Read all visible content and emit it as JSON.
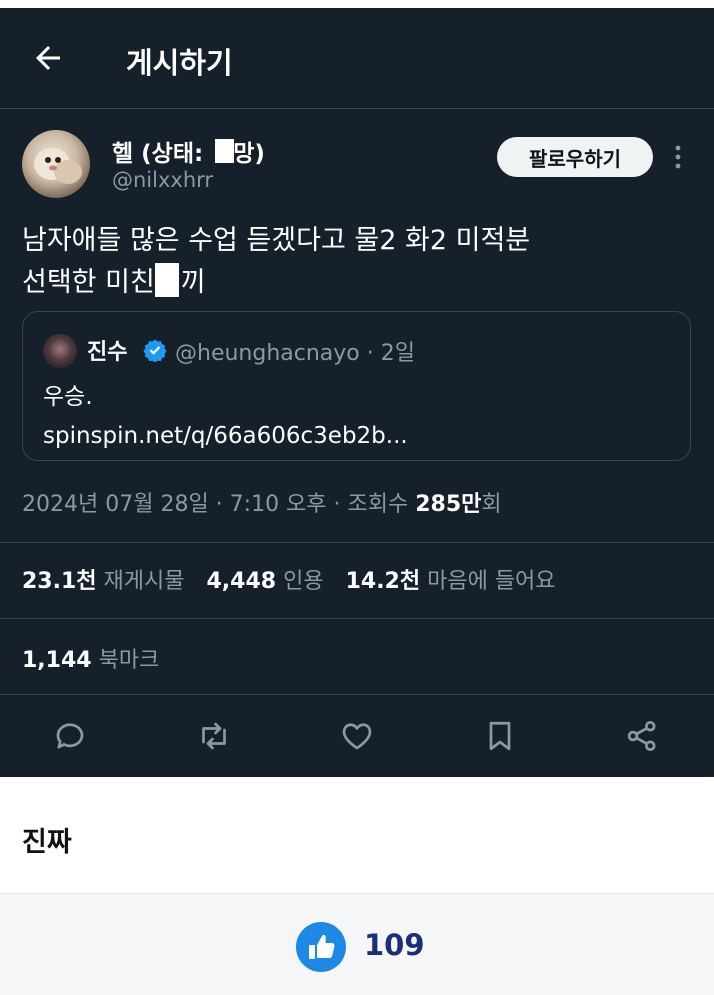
{
  "header": {
    "title": "게시하기"
  },
  "author": {
    "name_prefix": "헬 (상태: ",
    "name_suffix": "망)",
    "handle": "@nilxxhrr",
    "follow_label": "팔로우하기"
  },
  "tweet": {
    "line1": "남자애들 많은 수업 듣겠다고 물2 화2 미적분",
    "line2_prefix": "선택한 미친",
    "line2_suffix": "끼"
  },
  "quote": {
    "name": "진수",
    "handle_meta": "@heunghacnayo · 2일",
    "text_line1": "우승.",
    "text_line2": "spinspin.net/q/66a606c3eb2b..."
  },
  "meta": {
    "timestamp": "2024년 07월 28일 · 7:10 오후 · 조회수 ",
    "views": "285만",
    "views_suffix": "회"
  },
  "stats": {
    "retweets": "23.1천",
    "retweets_label": " 재게시물",
    "quotes": "4,448",
    "quotes_label": " 인용",
    "likes": "14.2천",
    "likes_label": " 마음에 들어요",
    "bookmarks": "1,144",
    "bookmarks_label": " 북마크"
  },
  "post": {
    "comment": "진짜",
    "like_count": "109"
  },
  "colors": {
    "background": "#15202b",
    "border": "#38444d",
    "muted_text": "#8b98a5",
    "verified": "#1d9bf0",
    "like_button": "#1e88e5",
    "like_count": "#1a2f7a"
  },
  "icons": [
    "back-arrow-icon",
    "more-icon",
    "verified-badge-icon",
    "reply-icon",
    "retweet-icon",
    "heart-icon",
    "bookmark-icon",
    "share-icon",
    "thumbs-up-icon"
  ]
}
